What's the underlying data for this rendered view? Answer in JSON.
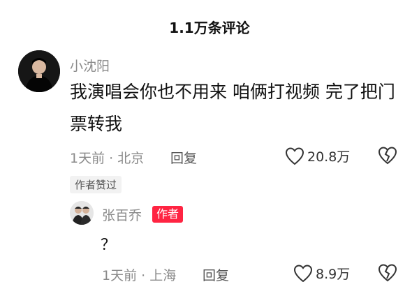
{
  "header": {
    "title": "1.1万条评论"
  },
  "comment": {
    "user": "小沈阳",
    "text_line1": "我演唱会你也不用来 咱俩打视频 完了把门",
    "text_line2": "票转我",
    "time": "1天前 · 北京",
    "reply_label": "回复",
    "likes": "20.8万",
    "author_liked": "作者赞过"
  },
  "reply": {
    "user": "张百乔",
    "badge": "作者",
    "text": "？",
    "time": "1天前 · 上海",
    "reply_label": "回复",
    "likes": "8.9万"
  },
  "icons": {
    "like": "heart-outline-icon",
    "dislike": "broken-heart-icon"
  }
}
